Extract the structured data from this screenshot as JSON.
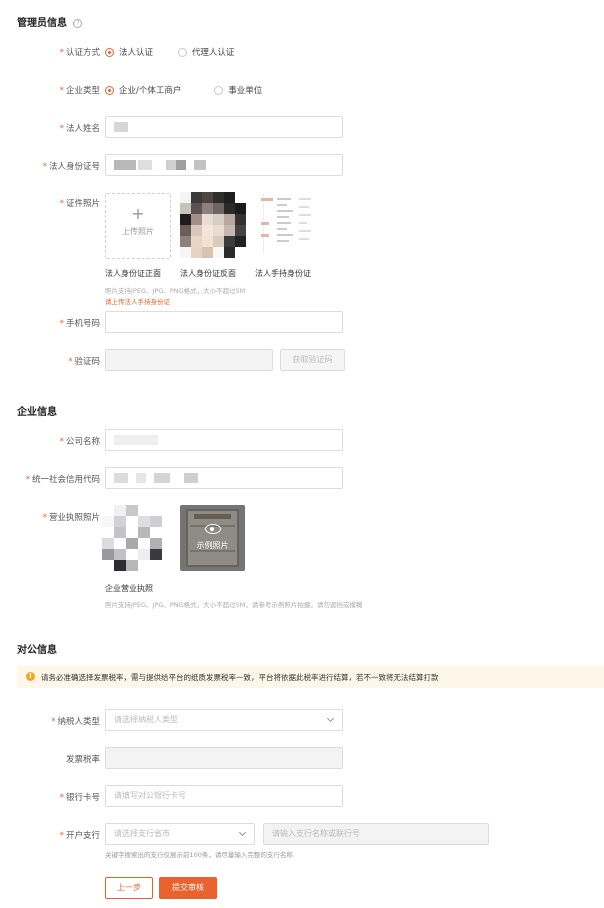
{
  "admin": {
    "title": "管理员信息",
    "auth_method": {
      "label": "认证方式",
      "options": [
        "法人认证",
        "代理人认证"
      ],
      "selected": 0
    },
    "company_type": {
      "label": "企业类型",
      "options": [
        "企业/个体工商户",
        "事业单位"
      ],
      "selected": 0
    },
    "legal_name": {
      "label": "法人姓名"
    },
    "legal_id": {
      "label": "法人身份证号"
    },
    "id_photos": {
      "label": "证件照片",
      "upload_text": "上传照片",
      "captions": [
        "法人身份证正面",
        "法人身份证反面",
        "法人手持身份证"
      ],
      "hint": "照片支持JPEG、JPG、PNG格式，大小不超过5M",
      "error": "请上传法人手持身份证"
    },
    "phone": {
      "label": "手机号码"
    },
    "code": {
      "label": "验证码",
      "button": "获取验证码"
    }
  },
  "company": {
    "title": "企业信息",
    "name": {
      "label": "公司名称"
    },
    "credit_code": {
      "label": "统一社会信用代码"
    },
    "license": {
      "label": "营业执照照片",
      "sample_text": "示例照片",
      "caption": "企业营业执照",
      "hint": "照片支持JPEG、JPG、PNG格式，大小不超过5M，请参考示例照片拍摄，请勿遮挡或模糊"
    }
  },
  "public": {
    "title": "对公信息",
    "notice": "请务必准确选择发票税率，需与提供给平台的纸质发票税率一致，平台将依据此税率进行结算，若不一致将无法结算打款",
    "taxpayer_type": {
      "label": "纳税人类型",
      "placeholder": "请选择纳税人类型"
    },
    "tax_rate": {
      "label": "发票税率"
    },
    "bank_card": {
      "label": "银行卡号",
      "placeholder": "请填写对公银行卡号"
    },
    "branch": {
      "label": "开户支行",
      "province_placeholder": "请选择支行省市",
      "name_placeholder": "请输入支行名称或联行号",
      "hint": "关键字搜索出的支行仅展示前100条，请尽量输入完整的支行名称"
    }
  },
  "actions": {
    "prev": "上一步",
    "submit": "提交审核"
  },
  "colors": {
    "accent": "#e8632e",
    "notice_bg": "#fdf6e9",
    "notice_icon": "#f5a623"
  }
}
